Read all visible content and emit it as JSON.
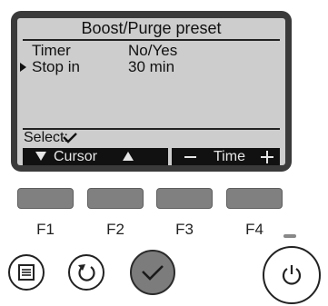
{
  "screen": {
    "title": "Boost/Purge preset",
    "rows": [
      {
        "label": "Timer",
        "value": "No/Yes",
        "selected": false
      },
      {
        "label": "Stop in",
        "value": "30 min",
        "selected": true
      }
    ],
    "select_label": "Select:",
    "function_bar": {
      "cursor_label": "Cursor",
      "time_label": "Time"
    }
  },
  "function_keys": [
    "F1",
    "F2",
    "F3",
    "F4"
  ],
  "buttons": {
    "menu_icon": "menu-list-icon",
    "return_icon": "return-arrow-icon",
    "select_icon": "checkmark-icon",
    "power_icon": "power-icon"
  },
  "colors": {
    "lcd_background": "#cdcdcd",
    "bezel": "#3a3a3a",
    "function_key": "#808080",
    "select_button": "#7c7c7c"
  }
}
